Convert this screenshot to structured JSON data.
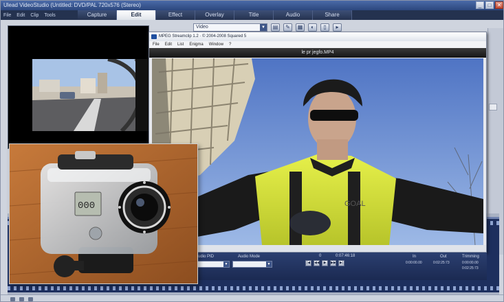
{
  "app": {
    "title": "Ulead VideoStudio (Untitled: DVD/PAL 720x576 (Stereo)",
    "window_controls": [
      "_",
      "□",
      "✕"
    ],
    "menu": [
      "File",
      "Edit",
      "Clip",
      "Tools"
    ],
    "steps": [
      {
        "label": "Capture",
        "active": false
      },
      {
        "label": "Edit",
        "active": true
      },
      {
        "label": "Effect",
        "active": false
      },
      {
        "label": "Overlay",
        "active": false
      },
      {
        "label": "Title",
        "active": false
      },
      {
        "label": "Audio",
        "active": false
      },
      {
        "label": "Share",
        "active": false
      }
    ],
    "library_combo": "Video"
  },
  "player": {
    "title": "MPEG Streamclip 1.2 · © 2004-2008 Squared 5",
    "menu": [
      "File",
      "Edit",
      "List",
      "Enigma",
      "Window",
      "?"
    ],
    "file_name": "le pr jegfo.MP4"
  },
  "controls": {
    "audio_pid_label": "Audio PID",
    "audio_mode_label": "Audio Mode",
    "in_label": "In",
    "out_label": "Out",
    "trimming_label": "Trimming",
    "frame_label": "0",
    "current_time": "0:07:46:18",
    "in_value": "0:00:00.00",
    "out_value": "0:02:25:73",
    "trim_value_1": "0:00:00.00",
    "trim_value_2": "0:02:25:73",
    "transport": [
      "|◀",
      "◀◀",
      "▶",
      "▶▶",
      "▶|"
    ]
  },
  "colors": {
    "menubar": "#24324f",
    "sky": "#6c8fd2",
    "jersey": "#d8e83a"
  }
}
